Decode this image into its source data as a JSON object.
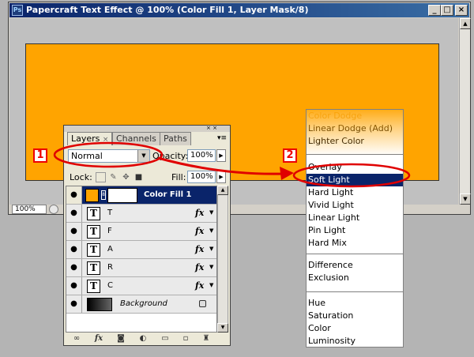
{
  "window": {
    "app_icon": "Ps",
    "title": "Papercraft Text Effect @ 100% (Color Fill 1, Layer Mask/8)",
    "buttons": [
      "_",
      "□",
      "×"
    ]
  },
  "status": {
    "zoom": "100%"
  },
  "panel": {
    "tabs": [
      {
        "label": "Layers",
        "close": "×"
      },
      {
        "label": "Channels"
      },
      {
        "label": "Paths"
      }
    ],
    "blend_mode": "Normal",
    "opacity_label": "Opacity:",
    "opacity_value": "100%",
    "lock_label": "Lock:",
    "fill_label": "Fill:",
    "fill_value": "100%",
    "layers": [
      {
        "name": "Color Fill 1",
        "selected": true,
        "kind": "fill"
      },
      {
        "name": "T",
        "kind": "text",
        "fx": "fx"
      },
      {
        "name": "F",
        "kind": "text",
        "fx": "fx"
      },
      {
        "name": "A",
        "kind": "text",
        "fx": "fx"
      },
      {
        "name": "R",
        "kind": "text",
        "fx": "fx"
      },
      {
        "name": "C",
        "kind": "text",
        "fx": "fx"
      },
      {
        "name": "Background",
        "kind": "background"
      }
    ],
    "text_glyph": "T",
    "fx_glyph": "fx"
  },
  "menu": {
    "items": [
      {
        "label": "Color Dodge",
        "faded": true
      },
      {
        "label": "Linear Dodge (Add)"
      },
      {
        "label": "Lighter Color"
      },
      {
        "separator": true
      },
      {
        "label": "Overlay"
      },
      {
        "label": "Soft Light",
        "highlighted": true
      },
      {
        "label": "Hard Light"
      },
      {
        "label": "Vivid Light"
      },
      {
        "label": "Linear Light"
      },
      {
        "label": "Pin Light"
      },
      {
        "label": "Hard Mix"
      },
      {
        "separator": true
      },
      {
        "label": "Difference"
      },
      {
        "label": "Exclusion"
      },
      {
        "separator": true
      },
      {
        "label": "Hue"
      },
      {
        "label": "Saturation"
      },
      {
        "label": "Color"
      },
      {
        "label": "Luminosity"
      }
    ]
  },
  "callouts": {
    "first": "1",
    "second": "2"
  },
  "colors": {
    "canvas": "#ffa400",
    "highlight": "#0a246a",
    "annotation": "#e00000"
  }
}
